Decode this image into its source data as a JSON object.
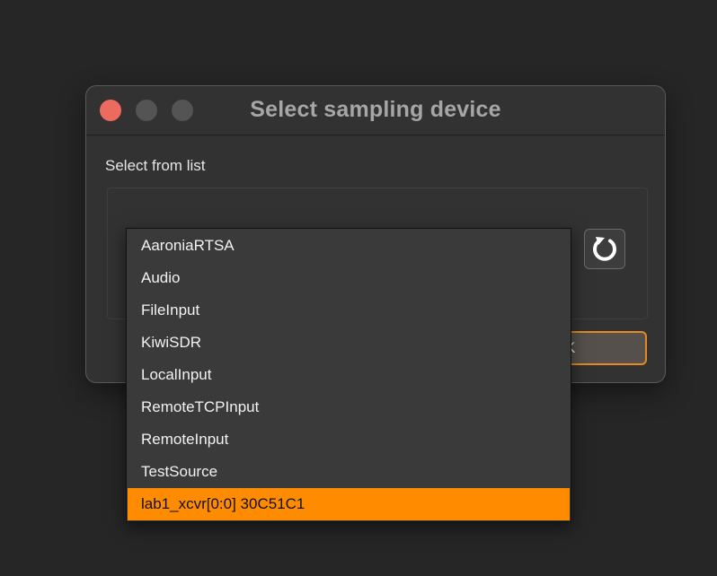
{
  "dialog": {
    "title": "Select sampling device",
    "section_label": "Select from list",
    "ok_label": "OK",
    "refresh_icon": "refresh-icon"
  },
  "device_list": {
    "items": [
      "AaroniaRTSA",
      "Audio",
      "FileInput",
      "KiwiSDR",
      "LocalInput",
      "RemoteTCPInput",
      "RemoteInput",
      "TestSource",
      "lab1_xcvr[0:0] 30C51C1"
    ],
    "selected_index": 8
  },
  "colors": {
    "accent": "#ff8c00",
    "close": "#ed6a5e",
    "background": "#262626",
    "dialog": "#323232"
  }
}
